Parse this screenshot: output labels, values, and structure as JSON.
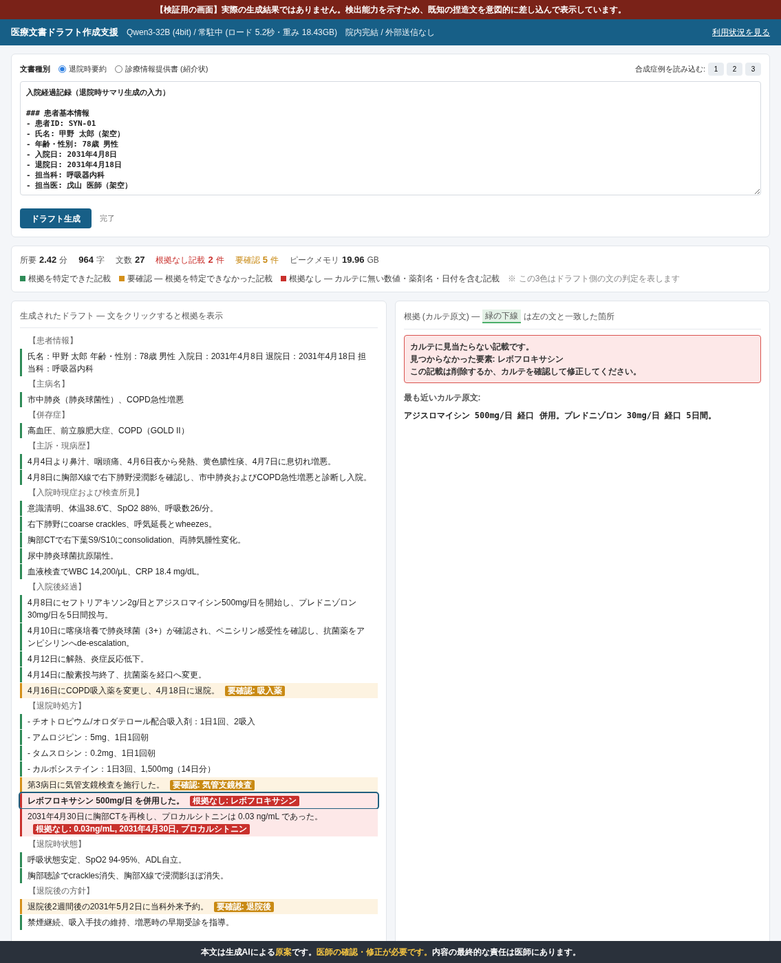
{
  "banner": "【検証用の画面】実際の生成結果ではありません。検出能力を示すため、既知の捏造文を意図的に差し込んで表示しています。",
  "header": {
    "title": "医療文書ドラフト作成支援",
    "model": "Qwen3-32B (4bit) / 常駐中 (ロード 5.2秒・重み 18.43GB)",
    "scope": "院内完結 / 外部送信なし",
    "link": "利用状況を見る"
  },
  "input": {
    "doc_type_label": "文書種別",
    "doc_types": [
      {
        "label": "退院時要約",
        "selected": true
      },
      {
        "label": "診療情報提供書 (紹介状)",
        "selected": false
      }
    ],
    "samples_label": "合成症例を読み込む:",
    "samples": [
      "1",
      "2",
      "3"
    ],
    "record": "入院経過記録（退院時サマリ生成の入力）\n\n### 患者基本情報\n- 患者ID: SYN-01\n- 氏名: 甲野 太郎（架空）\n- 年齢・性別: 78歳 男性\n- 入院日: 2031年4月8日\n- 退院日: 2031年4月18日\n- 担当科: 呼吸器内科\n- 担当医: 戊山 医師（架空）",
    "generate_button": "ドラフト生成",
    "status": "完了"
  },
  "stats": [
    {
      "label": "所要",
      "value": "2.42",
      "unit": "分",
      "kind": "plain"
    },
    {
      "value": "964",
      "unit": "字",
      "kind": "plain"
    },
    {
      "label": "文数",
      "value": "27",
      "kind": "plain"
    },
    {
      "label": "根拠なし記載",
      "value": "2",
      "unit": "件",
      "kind": "none"
    },
    {
      "label": "要確認",
      "value": "5",
      "unit": "件",
      "kind": "check"
    },
    {
      "label": "ピークメモリ",
      "value": "19.96",
      "unit": "GB",
      "kind": "plain"
    }
  ],
  "legend": [
    {
      "label": "根拠を特定できた記載",
      "color": "#2e8b57"
    },
    {
      "label": "要確認 — 根拠を特定できなかった記載",
      "color": "#d4901a"
    },
    {
      "label": "根拠なし — カルテに無い数値・薬剤名・日付を含む記載",
      "color": "#c9302c"
    }
  ],
  "legend_note": "※ この3色はドラフト側の文の判定を表します",
  "draft": {
    "title": "生成されたドラフト — 文をクリックすると根拠を表示",
    "items": [
      {
        "kind": "heading",
        "text": "【患者情報】"
      },
      {
        "kind": "ok",
        "text": "氏名：甲野 太郎 年齢・性別：78歳 男性 入院日：2031年4月8日 退院日：2031年4月18日 担当科：呼吸器内科",
        "selected": false
      },
      {
        "kind": "heading",
        "text": "【主病名】"
      },
      {
        "kind": "ok",
        "text": "市中肺炎（肺炎球菌性）、COPD急性増悪",
        "selected": false
      },
      {
        "kind": "heading",
        "text": "【併存症】"
      },
      {
        "kind": "ok",
        "text": "高血圧、前立腺肥大症、COPD（GOLD II）",
        "selected": false
      },
      {
        "kind": "heading",
        "text": "【主訴・現病歴】"
      },
      {
        "kind": "ok",
        "text": "4月4日より鼻汁、咽頭痛、4月6日夜から発熱、黄色膿性痰、4月7日に息切れ増悪。",
        "selected": false
      },
      {
        "kind": "ok",
        "text": "4月8日に胸部X線で右下肺野浸潤影を確認し、市中肺炎およびCOPD急性増悪と診断し入院。",
        "selected": false
      },
      {
        "kind": "heading",
        "text": "【入院時現症および検査所見】"
      },
      {
        "kind": "ok",
        "text": "意識清明、体温38.6℃、SpO2 88%、呼吸数26/分。",
        "selected": false
      },
      {
        "kind": "ok",
        "text": "右下肺野にcoarse crackles、呼気延長とwheezes。",
        "selected": false
      },
      {
        "kind": "ok",
        "text": "胸部CTで右下葉S9/S10にconsolidation、両肺気腫性変化。",
        "selected": false
      },
      {
        "kind": "ok",
        "text": "尿中肺炎球菌抗原陽性。",
        "selected": false
      },
      {
        "kind": "ok",
        "text": "血液検査でWBC 14,200/μL、CRP 18.4 mg/dL。",
        "selected": false
      },
      {
        "kind": "heading",
        "text": "【入院後経過】"
      },
      {
        "kind": "ok",
        "text": "4月8日にセフトリアキソン2g/日とアジスロマイシン500mg/日を開始し、プレドニゾロン30mg/日を5日間投与。",
        "selected": false
      },
      {
        "kind": "ok",
        "text": "4月10日に喀痰培養で肺炎球菌（3+）が確認され、ペニシリン感受性を確認し、抗菌薬をアンピシリンへde-escalation。",
        "selected": false
      },
      {
        "kind": "ok",
        "text": "4月12日に解熱、炎症反応低下。",
        "selected": false
      },
      {
        "kind": "ok",
        "text": "4月14日に酸素投与終了、抗菌薬を経口へ変更。",
        "selected": false
      },
      {
        "kind": "check",
        "text": "4月16日にCOPD吸入薬を変更し、4月18日に退院。",
        "tag": "要確認: 吸入薬",
        "selected": false
      },
      {
        "kind": "heading",
        "text": "【退院時処方】"
      },
      {
        "kind": "ok",
        "text": "- チオトロピウム/オロダテロール配合吸入剤：1日1回、2吸入",
        "selected": false
      },
      {
        "kind": "ok",
        "text": "- アムロジピン：5mg、1日1回朝",
        "selected": false
      },
      {
        "kind": "ok",
        "text": "- タムスロシン：0.2mg、1日1回朝",
        "selected": false
      },
      {
        "kind": "ok",
        "text": "- カルボシステイン：1日3回、1,500mg（14日分）",
        "selected": false
      },
      {
        "kind": "check",
        "text": "第3病日に気管支鏡検査を施行した。",
        "tag": "要確認: 気管支鏡検査",
        "selected": false
      },
      {
        "kind": "none",
        "text": "レボフロキサシン 500mg/日 を併用した。",
        "tag": "根拠なし: レボフロキサシン",
        "selected": true
      },
      {
        "kind": "none",
        "text": "2031年4月30日に胸部CTを再検し、プロカルシトニンは 0.03 ng/mL であった。",
        "tag": "根拠なし: 0.03ng/mL, 2031年4月30日, プロカルシトニン",
        "selected": false
      },
      {
        "kind": "heading",
        "text": "【退院時状態】"
      },
      {
        "kind": "ok",
        "text": "呼吸状態安定、SpO2 94-95%、ADL自立。",
        "selected": false
      },
      {
        "kind": "ok",
        "text": "胸部聴診でcrackles消失、胸部X線で浸潤影ほぼ消失。",
        "selected": false
      },
      {
        "kind": "heading",
        "text": "【退院後の方針】"
      },
      {
        "kind": "check",
        "text": "退院後2週間後の2031年5月2日に当科外来予約。",
        "tag": "要確認: 退院後",
        "selected": false
      },
      {
        "kind": "ok",
        "text": "禁煙継続、吸入手技の維持、増悪時の早期受診を指導。",
        "selected": false
      }
    ]
  },
  "evidence": {
    "title_prefix": "根拠 (カルテ原文) —",
    "title_highlight": "緑の下線",
    "title_suffix": "は左の文と一致した箇所",
    "alert": [
      "カルテに見当たらない記載です。",
      "見つからなかった要素: レボフロキサシン",
      "この記載は削除するか、カルテを確認して修正してください。"
    ],
    "nearest_label": "最も近いカルテ原文:",
    "nearest_text": "アジスロマイシン 500mg/日 経口 併用。プレドニゾロン 30mg/日 経口 5日間。"
  },
  "footer": "本文は生成AIによる**原案**です。**医師の確認・修正が必要です。**内容の最終的な責任は医師にあります。"
}
